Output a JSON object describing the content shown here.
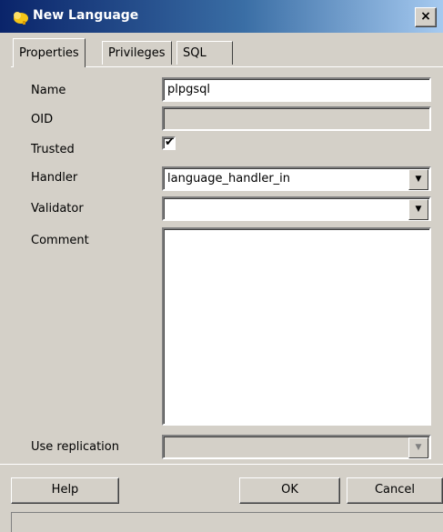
{
  "window": {
    "title": "New Language",
    "close_glyph": "×"
  },
  "tabs": [
    {
      "label": "Properties",
      "active": true
    },
    {
      "label": "Privileges",
      "active": false
    },
    {
      "label": "SQL",
      "active": false
    }
  ],
  "form": {
    "name": {
      "label": "Name",
      "value": "plpgsql"
    },
    "oid": {
      "label": "OID",
      "value": ""
    },
    "trusted": {
      "label": "Trusted",
      "checked": true,
      "check_glyph": "✔"
    },
    "handler": {
      "label": "Handler",
      "value": "language_handler_in",
      "arrow": "▼"
    },
    "validator": {
      "label": "Validator",
      "value": "",
      "arrow": "▼"
    },
    "comment": {
      "label": "Comment",
      "value": ""
    },
    "use_replication": {
      "label": "Use replication",
      "value": "",
      "arrow": "▼"
    }
  },
  "buttons": {
    "help": "Help",
    "ok": "OK",
    "cancel": "Cancel"
  },
  "icons": {
    "title_icon": "elephant-icon",
    "close": "close-icon",
    "dropdown": "chevron-down-icon"
  },
  "colors": {
    "title_bar_start": "#0a246a",
    "title_bar_end": "#a6caf0",
    "dialog_bg": "#d4d0c8"
  }
}
